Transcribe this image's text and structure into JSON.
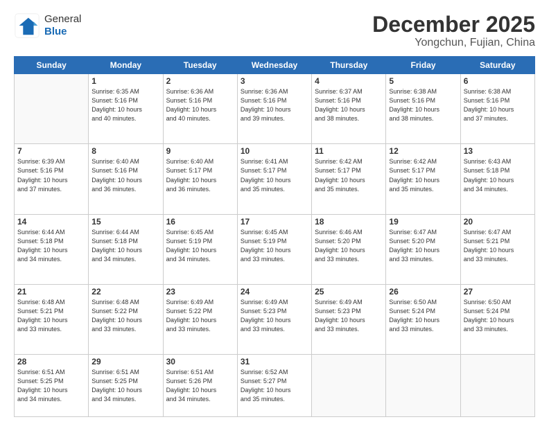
{
  "logo": {
    "general": "General",
    "blue": "Blue"
  },
  "title": {
    "month": "December 2025",
    "location": "Yongchun, Fujian, China"
  },
  "days_header": [
    "Sunday",
    "Monday",
    "Tuesday",
    "Wednesday",
    "Thursday",
    "Friday",
    "Saturday"
  ],
  "weeks": [
    [
      {
        "num": "",
        "info": ""
      },
      {
        "num": "1",
        "info": "Sunrise: 6:35 AM\nSunset: 5:16 PM\nDaylight: 10 hours\nand 40 minutes."
      },
      {
        "num": "2",
        "info": "Sunrise: 6:36 AM\nSunset: 5:16 PM\nDaylight: 10 hours\nand 40 minutes."
      },
      {
        "num": "3",
        "info": "Sunrise: 6:36 AM\nSunset: 5:16 PM\nDaylight: 10 hours\nand 39 minutes."
      },
      {
        "num": "4",
        "info": "Sunrise: 6:37 AM\nSunset: 5:16 PM\nDaylight: 10 hours\nand 38 minutes."
      },
      {
        "num": "5",
        "info": "Sunrise: 6:38 AM\nSunset: 5:16 PM\nDaylight: 10 hours\nand 38 minutes."
      },
      {
        "num": "6",
        "info": "Sunrise: 6:38 AM\nSunset: 5:16 PM\nDaylight: 10 hours\nand 37 minutes."
      }
    ],
    [
      {
        "num": "7",
        "info": "Sunrise: 6:39 AM\nSunset: 5:16 PM\nDaylight: 10 hours\nand 37 minutes."
      },
      {
        "num": "8",
        "info": "Sunrise: 6:40 AM\nSunset: 5:16 PM\nDaylight: 10 hours\nand 36 minutes."
      },
      {
        "num": "9",
        "info": "Sunrise: 6:40 AM\nSunset: 5:17 PM\nDaylight: 10 hours\nand 36 minutes."
      },
      {
        "num": "10",
        "info": "Sunrise: 6:41 AM\nSunset: 5:17 PM\nDaylight: 10 hours\nand 35 minutes."
      },
      {
        "num": "11",
        "info": "Sunrise: 6:42 AM\nSunset: 5:17 PM\nDaylight: 10 hours\nand 35 minutes."
      },
      {
        "num": "12",
        "info": "Sunrise: 6:42 AM\nSunset: 5:17 PM\nDaylight: 10 hours\nand 35 minutes."
      },
      {
        "num": "13",
        "info": "Sunrise: 6:43 AM\nSunset: 5:18 PM\nDaylight: 10 hours\nand 34 minutes."
      }
    ],
    [
      {
        "num": "14",
        "info": "Sunrise: 6:44 AM\nSunset: 5:18 PM\nDaylight: 10 hours\nand 34 minutes."
      },
      {
        "num": "15",
        "info": "Sunrise: 6:44 AM\nSunset: 5:18 PM\nDaylight: 10 hours\nand 34 minutes."
      },
      {
        "num": "16",
        "info": "Sunrise: 6:45 AM\nSunset: 5:19 PM\nDaylight: 10 hours\nand 34 minutes."
      },
      {
        "num": "17",
        "info": "Sunrise: 6:45 AM\nSunset: 5:19 PM\nDaylight: 10 hours\nand 33 minutes."
      },
      {
        "num": "18",
        "info": "Sunrise: 6:46 AM\nSunset: 5:20 PM\nDaylight: 10 hours\nand 33 minutes."
      },
      {
        "num": "19",
        "info": "Sunrise: 6:47 AM\nSunset: 5:20 PM\nDaylight: 10 hours\nand 33 minutes."
      },
      {
        "num": "20",
        "info": "Sunrise: 6:47 AM\nSunset: 5:21 PM\nDaylight: 10 hours\nand 33 minutes."
      }
    ],
    [
      {
        "num": "21",
        "info": "Sunrise: 6:48 AM\nSunset: 5:21 PM\nDaylight: 10 hours\nand 33 minutes."
      },
      {
        "num": "22",
        "info": "Sunrise: 6:48 AM\nSunset: 5:22 PM\nDaylight: 10 hours\nand 33 minutes."
      },
      {
        "num": "23",
        "info": "Sunrise: 6:49 AM\nSunset: 5:22 PM\nDaylight: 10 hours\nand 33 minutes."
      },
      {
        "num": "24",
        "info": "Sunrise: 6:49 AM\nSunset: 5:23 PM\nDaylight: 10 hours\nand 33 minutes."
      },
      {
        "num": "25",
        "info": "Sunrise: 6:49 AM\nSunset: 5:23 PM\nDaylight: 10 hours\nand 33 minutes."
      },
      {
        "num": "26",
        "info": "Sunrise: 6:50 AM\nSunset: 5:24 PM\nDaylight: 10 hours\nand 33 minutes."
      },
      {
        "num": "27",
        "info": "Sunrise: 6:50 AM\nSunset: 5:24 PM\nDaylight: 10 hours\nand 33 minutes."
      }
    ],
    [
      {
        "num": "28",
        "info": "Sunrise: 6:51 AM\nSunset: 5:25 PM\nDaylight: 10 hours\nand 34 minutes."
      },
      {
        "num": "29",
        "info": "Sunrise: 6:51 AM\nSunset: 5:25 PM\nDaylight: 10 hours\nand 34 minutes."
      },
      {
        "num": "30",
        "info": "Sunrise: 6:51 AM\nSunset: 5:26 PM\nDaylight: 10 hours\nand 34 minutes."
      },
      {
        "num": "31",
        "info": "Sunrise: 6:52 AM\nSunset: 5:27 PM\nDaylight: 10 hours\nand 35 minutes."
      },
      {
        "num": "",
        "info": ""
      },
      {
        "num": "",
        "info": ""
      },
      {
        "num": "",
        "info": ""
      }
    ]
  ]
}
